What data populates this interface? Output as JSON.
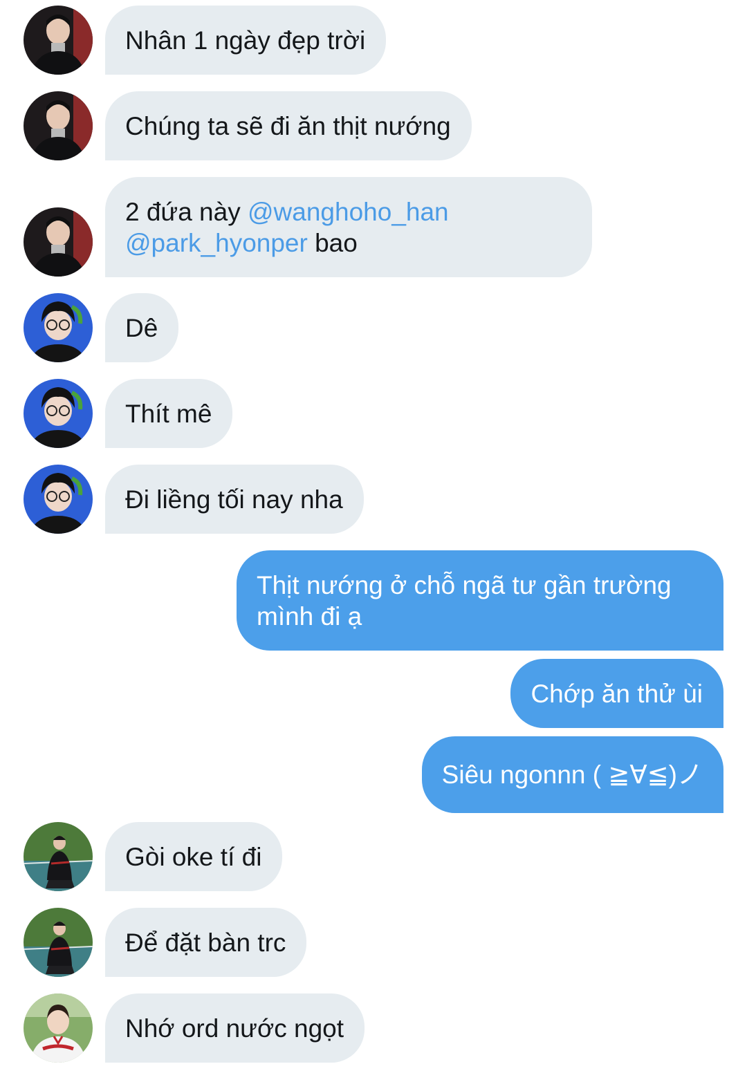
{
  "colors": {
    "incoming_bubble": "#e6ecf0",
    "outgoing_bubble": "#4c9fea",
    "mention": "#4b9be6",
    "text": "#14171a"
  },
  "messages": [
    {
      "direction": "incoming",
      "avatar": "user-a-avatar",
      "text": "Nhân 1 ngày đẹp trời"
    },
    {
      "direction": "incoming",
      "avatar": "user-a-avatar",
      "text": "Chúng ta sẽ đi ăn thịt nướng"
    },
    {
      "direction": "incoming",
      "avatar": "user-a-avatar",
      "text_parts": [
        "2 đứa này ",
        "@wanghoho_han",
        "@park_hyonper",
        " bao"
      ]
    },
    {
      "direction": "incoming",
      "avatar": "user-b-avatar",
      "text": "Dê"
    },
    {
      "direction": "incoming",
      "avatar": "user-b-avatar",
      "text": "Thít mê"
    },
    {
      "direction": "incoming",
      "avatar": "user-b-avatar",
      "text": "Đi liềng tối nay nha"
    },
    {
      "direction": "outgoing",
      "text": "Thịt nướng ở chỗ ngã tư gần trường mình đi ạ"
    },
    {
      "direction": "outgoing",
      "text": "Chớp ăn thử ùi"
    },
    {
      "direction": "outgoing",
      "text": "Siêu ngonnn ( ≧∀≦)ノ"
    },
    {
      "direction": "incoming",
      "avatar": "user-c-avatar",
      "text": "Gòi oke tí đi"
    },
    {
      "direction": "incoming",
      "avatar": "user-c-avatar",
      "text": "Để đặt bàn trc"
    },
    {
      "direction": "incoming",
      "avatar": "user-d-avatar",
      "text": "Nhớ ord nước ngọt"
    }
  ]
}
